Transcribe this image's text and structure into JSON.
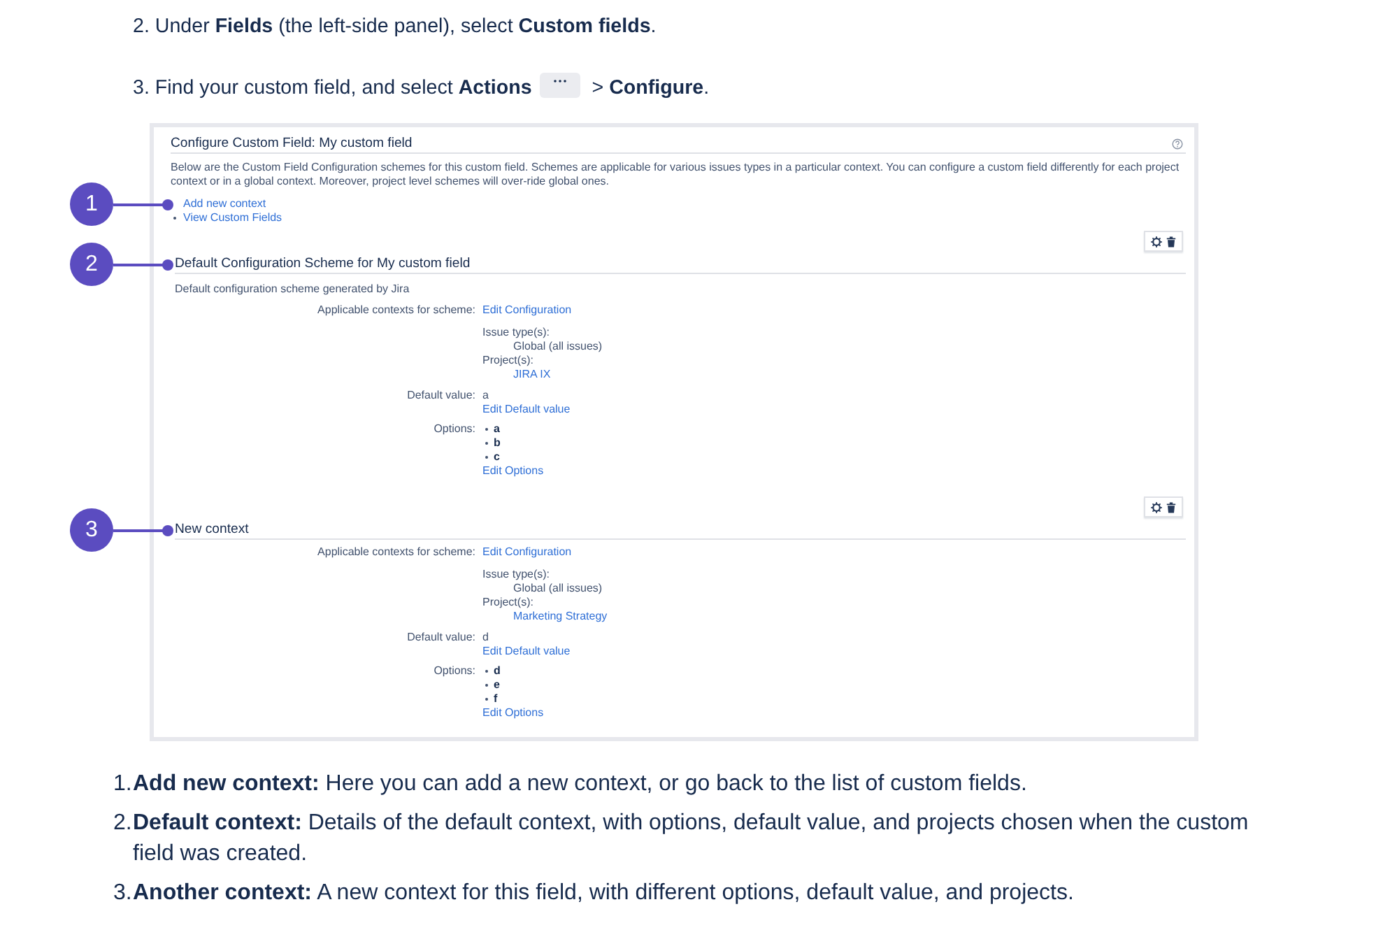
{
  "steps": [
    {
      "text": "2. Under **Fields** (the left-side panel), select **Custom fields**."
    },
    {
      "text": "3. Find your custom field, and select **Actions**",
      "continuation": "> **Configure**."
    }
  ],
  "screenshot": {
    "title": "Configure Custom Field: My custom field",
    "description": "Below are the Custom Field Configuration schemes for this custom field. Schemes are applicable for various issues types in a particular context. You can configure a custom field differently for each project context or in a global context. Moreover, project level schemes will over-ride global ones.",
    "links": [
      {
        "label": "Add new context",
        "callout": "1"
      },
      {
        "label": "View Custom Fields"
      }
    ],
    "schemes": [
      {
        "callout": "2",
        "heading": "Default Configuration Scheme for My custom field",
        "subtitle": "Default configuration scheme generated by Jira",
        "applicable_label": "Applicable contexts for scheme:",
        "applicable_link": "Edit Configuration",
        "issue_types_label": "Issue type(s):",
        "issue_types": [
          "Global (all issues)"
        ],
        "projects_label": "Project(s):",
        "projects": [
          "JIRA IX"
        ],
        "default_value_label": "Default value:",
        "default_value": "a",
        "default_value_link": "Edit Default value",
        "options_label": "Options:",
        "options": [
          "a",
          "b",
          "c"
        ],
        "options_link": "Edit Options"
      },
      {
        "callout": "3",
        "heading": "New context",
        "applicable_label": "Applicable contexts for scheme:",
        "applicable_link": "Edit Configuration",
        "issue_types_label": "Issue type(s):",
        "issue_types": [
          "Global (all issues)"
        ],
        "projects_label": "Project(s):",
        "projects": [
          "Marketing Strategy"
        ],
        "default_value_label": "Default value:",
        "default_value": "d",
        "default_value_link": "Edit Default value",
        "options_label": "Options:",
        "options": [
          "d",
          "e",
          "f"
        ],
        "options_link": "Edit Options"
      }
    ]
  },
  "notes": [
    {
      "number": "1.",
      "text": "**Add new context:** Here you can add a new context, or go back to the list of custom fields."
    },
    {
      "number": "2.",
      "text": "**Default context:** Details of the default context, with options, default value, and projects chosen when the custom field was created."
    },
    {
      "number": "3.",
      "text": "**Another context:** A new context for this field, with different options, default value, and projects."
    }
  ]
}
